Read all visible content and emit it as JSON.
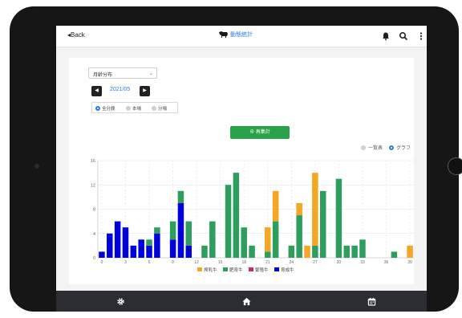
{
  "header": {
    "back_label": "Back",
    "logo_text": "動態統計"
  },
  "controls": {
    "select_value": "月齢分布",
    "month_label": "2021/05",
    "radio_options": [
      {
        "label": "全分娩",
        "selected": true
      },
      {
        "label": "本場",
        "selected": false
      },
      {
        "label": "分場",
        "selected": false
      }
    ],
    "recalc_label": "再集計",
    "view_options": [
      {
        "label": "一覧表",
        "selected": false
      },
      {
        "label": "グラフ",
        "selected": true
      }
    ]
  },
  "chart_data": {
    "type": "bar",
    "stacked": true,
    "ylim": [
      0,
      16
    ],
    "y_ticks": [
      0,
      4,
      8,
      12,
      16
    ],
    "x_ticks": [
      "0",
      "3",
      "6",
      "9",
      "12",
      "15",
      "18",
      "21",
      "24",
      "27",
      "30",
      "33",
      "36",
      "39"
    ],
    "categories": [
      "0",
      "1",
      "2",
      "3",
      "4",
      "5",
      "6",
      "7",
      "8",
      "9",
      "10",
      "11",
      "12",
      "13",
      "14",
      "15",
      "16",
      "17",
      "18",
      "19",
      "20",
      "21",
      "22",
      "23",
      "24",
      "25",
      "26",
      "27",
      "28",
      "29",
      "30",
      "31",
      "32",
      "33",
      "34",
      "35",
      "36",
      "37",
      "38",
      "39"
    ],
    "grid": true,
    "legend_position": "bottom",
    "series": [
      {
        "name": "育成牛",
        "color": "#0000dd",
        "values": [
          1,
          4,
          6,
          5,
          2,
          3,
          2,
          4,
          0,
          3,
          9,
          2,
          0,
          0,
          0,
          0,
          0,
          0,
          0,
          0,
          0,
          0,
          0,
          0,
          0,
          0,
          0,
          0,
          0,
          0,
          0,
          0,
          0,
          0,
          0,
          0,
          0,
          0,
          0,
          0
        ]
      },
      {
        "name": "肥育牛",
        "color": "#2e9e5e",
        "values": [
          0,
          0,
          0,
          0,
          0,
          0,
          1,
          1,
          0,
          3,
          2,
          4,
          0,
          2,
          6,
          0,
          12,
          14,
          5,
          2,
          0,
          1,
          6,
          0,
          2,
          7,
          0,
          2,
          11,
          0,
          13,
          2,
          2,
          3,
          0,
          0,
          0,
          1,
          0,
          0
        ]
      },
      {
        "name": "搾乳牛",
        "color": "#f5a623",
        "values": [
          0,
          0,
          0,
          0,
          0,
          0,
          0,
          0,
          0,
          0,
          0,
          0,
          0,
          0,
          0,
          0,
          0,
          0,
          0,
          0,
          0,
          4,
          5,
          0,
          0,
          2,
          2,
          12,
          0,
          0,
          0,
          0,
          0,
          0,
          0,
          0,
          0,
          0,
          0,
          2
        ]
      },
      {
        "name": "繁殖牛",
        "color": "#c0306a",
        "values": [
          0,
          0,
          0,
          0,
          0,
          0,
          0,
          0,
          0,
          0,
          0,
          0,
          0,
          0,
          0,
          0,
          0,
          0,
          0,
          0,
          0,
          0,
          0,
          0,
          0,
          0,
          0,
          0,
          0,
          0,
          0,
          0,
          0,
          0,
          0,
          0,
          0,
          0,
          0,
          0
        ]
      }
    ],
    "legend_order": [
      "搾乳牛",
      "肥育牛",
      "繁殖牛",
      "育成牛"
    ]
  },
  "footer": {
    "icons": [
      "gear-icon",
      "home-icon",
      "calendar-icon"
    ]
  },
  "colors": {
    "accent": "#2a7be0",
    "button_green": "#2aa24a",
    "footer_bg": "#2b2d32",
    "device": "#161616"
  }
}
